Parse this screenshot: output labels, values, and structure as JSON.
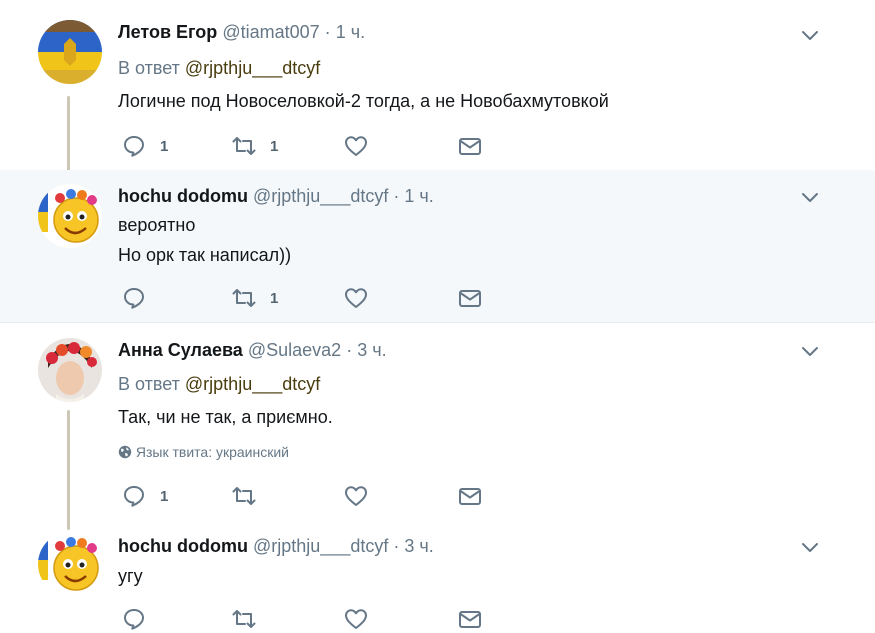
{
  "tweets": [
    {
      "fullname": "Летов Егор",
      "username": "@tiamat007",
      "sep": "·",
      "time": "1 ч.",
      "reply_label": "В ответ",
      "reply_mention": "@rjpthju___dtcyf",
      "lines": [
        "Логичне под Новоселовкой-2 тогда, а не Новобахмутовкой"
      ],
      "reply_count": "1",
      "retweet_count": "1"
    },
    {
      "fullname": "hochu dodomu",
      "username": "@rjpthju___dtcyf",
      "sep": "·",
      "time": "1 ч.",
      "lines": [
        "вероятно",
        "Но орк так написал))"
      ],
      "reply_count": "",
      "retweet_count": "1"
    },
    {
      "fullname": "Анна Сулаева",
      "username": "@Sulaeva2",
      "sep": "·",
      "time": "3 ч.",
      "reply_label": "В ответ",
      "reply_mention": "@rjpthju___dtcyf",
      "lines": [
        "Так, чи не так, а приємно."
      ],
      "language": "Язык твита: украинский",
      "reply_count": "1",
      "retweet_count": ""
    },
    {
      "fullname": "hochu dodomu",
      "username": "@rjpthju___dtcyf",
      "sep": "·",
      "time": "3 ч.",
      "lines": [
        "угу"
      ],
      "reply_count": "",
      "retweet_count": ""
    }
  ],
  "icons": {
    "reply": "reply-icon",
    "retweet": "retweet-icon",
    "like": "heart-icon",
    "dm": "envelope-icon",
    "caret": "chevron-down-icon",
    "globe": "globe-icon"
  },
  "colors": {
    "icon": "#657786",
    "highlight_bg": "#f5f8fa",
    "thread_line": "#ccc6b4",
    "mention": "#4a3d0f"
  }
}
